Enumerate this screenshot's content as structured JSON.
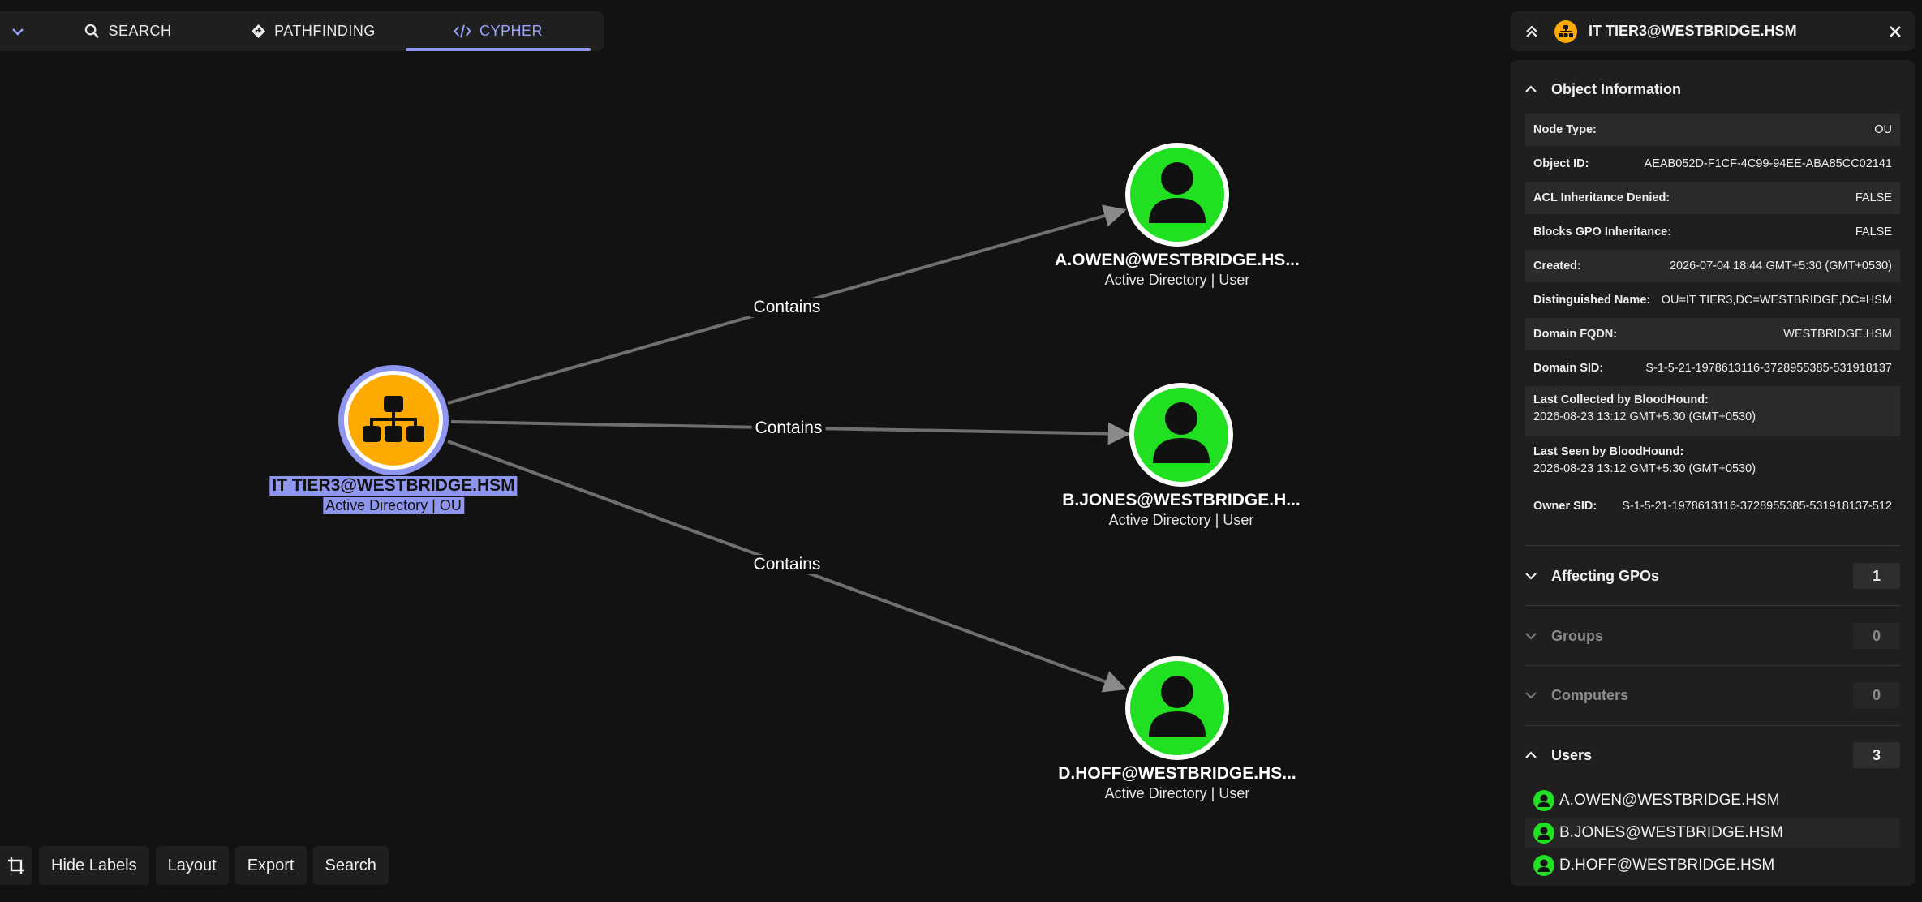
{
  "tabs": [
    {
      "label": "SEARCH",
      "icon": "search-icon"
    },
    {
      "label": "PATHFINDING",
      "icon": "pathfinding-icon"
    },
    {
      "label": "CYPHER",
      "icon": "code-icon",
      "active": true
    }
  ],
  "graph": {
    "source": {
      "name": "IT TIER3@WESTBRIDGE.HSM",
      "subtitle": "Active Directory | OU",
      "color": "#ffaa00",
      "selected": true
    },
    "targets": [
      {
        "name": "A.OWEN@WESTBRIDGE.HS...",
        "subtitle": "Active Directory | User",
        "color": "#21e021"
      },
      {
        "name": "B.JONES@WESTBRIDGE.H...",
        "subtitle": "Active Directory | User",
        "color": "#21e021"
      },
      {
        "name": "D.HOFF@WESTBRIDGE.HS...",
        "subtitle": "Active Directory | User",
        "color": "#21e021"
      }
    ],
    "edges": [
      "Contains",
      "Contains",
      "Contains"
    ]
  },
  "toolbar": {
    "buttons": [
      "Hide Labels",
      "Layout",
      "Export",
      "Search"
    ]
  },
  "panel": {
    "title": "IT TIER3@WESTBRIDGE.HSM",
    "object_info": {
      "heading": "Object Information",
      "props": [
        {
          "key": "Node Type:",
          "value": "OU"
        },
        {
          "key": "Object ID:",
          "value": "AEAB052D-F1CF-4C99-94EE-ABA85CC02141"
        },
        {
          "key": "ACL Inheritance Denied:",
          "value": "FALSE"
        },
        {
          "key": "Blocks GPO Inheritance:",
          "value": "FALSE"
        },
        {
          "key": "Created:",
          "value": "2026-07-04 18:44 GMT+5:30 (GMT+0530)"
        },
        {
          "key": "Distinguished Name:",
          "value": "OU=IT TIER3,DC=WESTBRIDGE,DC=HSM"
        },
        {
          "key": "Domain FQDN:",
          "value": "WESTBRIDGE.HSM"
        },
        {
          "key": "Domain SID:",
          "value": "S-1-5-21-1978613116-3728955385-531918137"
        },
        {
          "key": "Last Collected by BloodHound:",
          "value": "2026-08-23 13:12 GMT+5:30 (GMT+0530)"
        },
        {
          "key": "Last Seen by BloodHound:",
          "value": "2026-08-23 13:12 GMT+5:30 (GMT+0530)"
        },
        {
          "key": "Owner SID:",
          "value": "S-1-5-21-1978613116-3728955385-531918137-512"
        }
      ]
    },
    "sections": [
      {
        "label": "Affecting GPOs",
        "count": "1"
      },
      {
        "label": "Groups",
        "count": "0"
      },
      {
        "label": "Computers",
        "count": "0"
      },
      {
        "label": "Users",
        "count": "3"
      }
    ],
    "users": [
      "A.OWEN@WESTBRIDGE.HSM",
      "B.JONES@WESTBRIDGE.HSM",
      "D.HOFF@WESTBRIDGE.HSM"
    ]
  }
}
